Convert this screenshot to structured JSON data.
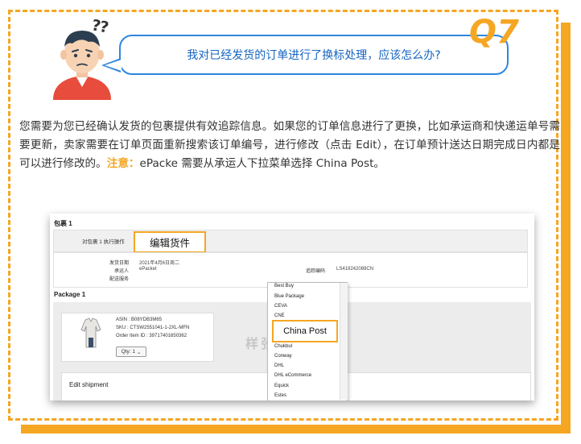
{
  "question": {
    "label": "Q7",
    "text": "我对已经发货的订单进行了换标处理，应该怎么办?",
    "confused_marks": "?? "
  },
  "answer": {
    "text_before_note": "您需要为您已经确认发货的包裹提供有效追踪信息。如果您的订单信息进行了更换，比如承运商和快递运单号需要更新，卖家需要在订单页面重新搜索该订单编号，进行修改（点击 Edit），在订单预计送达日期完成日内都是可以进行修改的。",
    "note_label": "注意：",
    "text_after_note": "ePacke 需要从承运人下拉菜单选择 China Post。"
  },
  "screenshot": {
    "package1_title": "包裹 1",
    "actions_label": "对包裹 1 执行操作",
    "edit_button": "编辑货件",
    "ship_date_label": "发货日期",
    "ship_date_value": "2021年4月6日周二",
    "carrier_label": "承运人",
    "carrier_value": "ePacket",
    "shipping_service_label": "配送服务",
    "tracking_label": "追踪编码",
    "tracking_value": "LS419242089CN",
    "package_title": "Package 1",
    "item": {
      "asin": "ASIN : B08YDB3M65",
      "sku": "SKU : CTSW2551041-1-2XL-MFN",
      "order_item_id": "Order Item ID : 39717401650362",
      "qty": "Qty: 1"
    },
    "watermark": "样张仅供参考",
    "edit_shipment_title": "Edit shipment",
    "carrier_options_before": [
      "Best Buy",
      "Blue Package",
      "CEVA",
      "CNE"
    ],
    "selected_carrier": "China Post",
    "carrier_options_after": [
      "Chukbul",
      "Conway",
      "DHL",
      "DHL eCommerce",
      "Equick",
      "Estes"
    ]
  },
  "colors": {
    "accent_orange": "#f5a623",
    "bubble_blue": "#2e86de",
    "question_text": "#1565c0"
  }
}
